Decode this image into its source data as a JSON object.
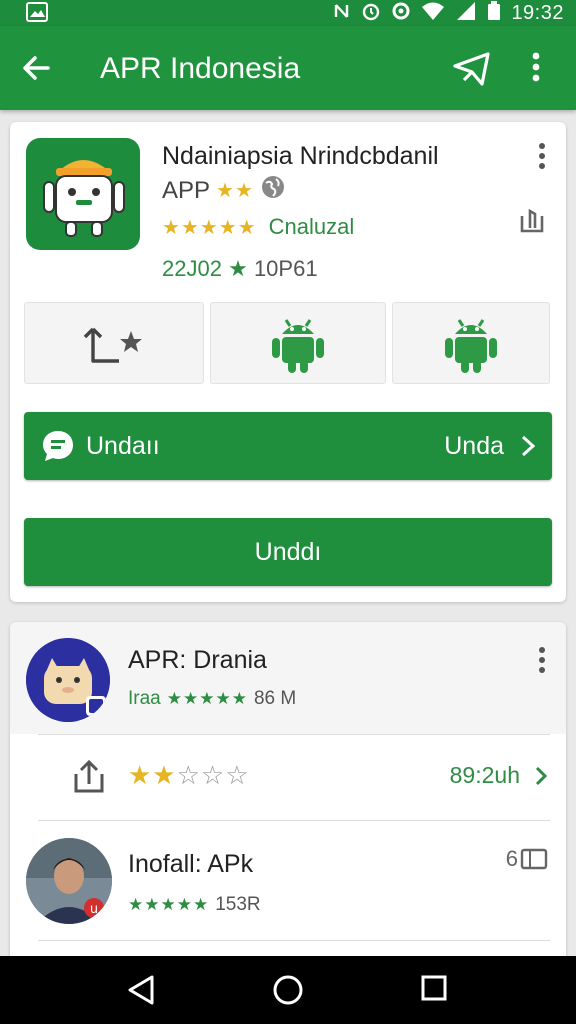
{
  "status_bar": {
    "time": "19:32"
  },
  "app_bar": {
    "title": "APR Indonesia"
  },
  "app": {
    "title": "Ndainiapsia Nrindcbdanil",
    "category": "APP",
    "category_stars": "★★",
    "rating_stars": "★★★★★",
    "rating_label": "Cnaluzal",
    "downloads": "22J02",
    "downloads_star": "★",
    "downloads_sub": "10P61"
  },
  "buttons": {
    "primary_left": "Undaıı",
    "primary_right": "Unda",
    "secondary": "Unddı"
  },
  "list": [
    {
      "title": "APR: Drania",
      "meta_prefix": "Iraa",
      "stars": "★★★★★",
      "size": "86 M"
    },
    {
      "stars_on": "★★",
      "stars_off": "☆☆☆",
      "time": "89:2uh"
    },
    {
      "title": "Inofall: APk",
      "meta_prefix": "",
      "stars": "★★★★★",
      "size": "153R",
      "badge": "6"
    }
  ],
  "colors": {
    "primary": "#20933f",
    "accent_star": "#e7b423",
    "text_green": "#2f8c43"
  }
}
